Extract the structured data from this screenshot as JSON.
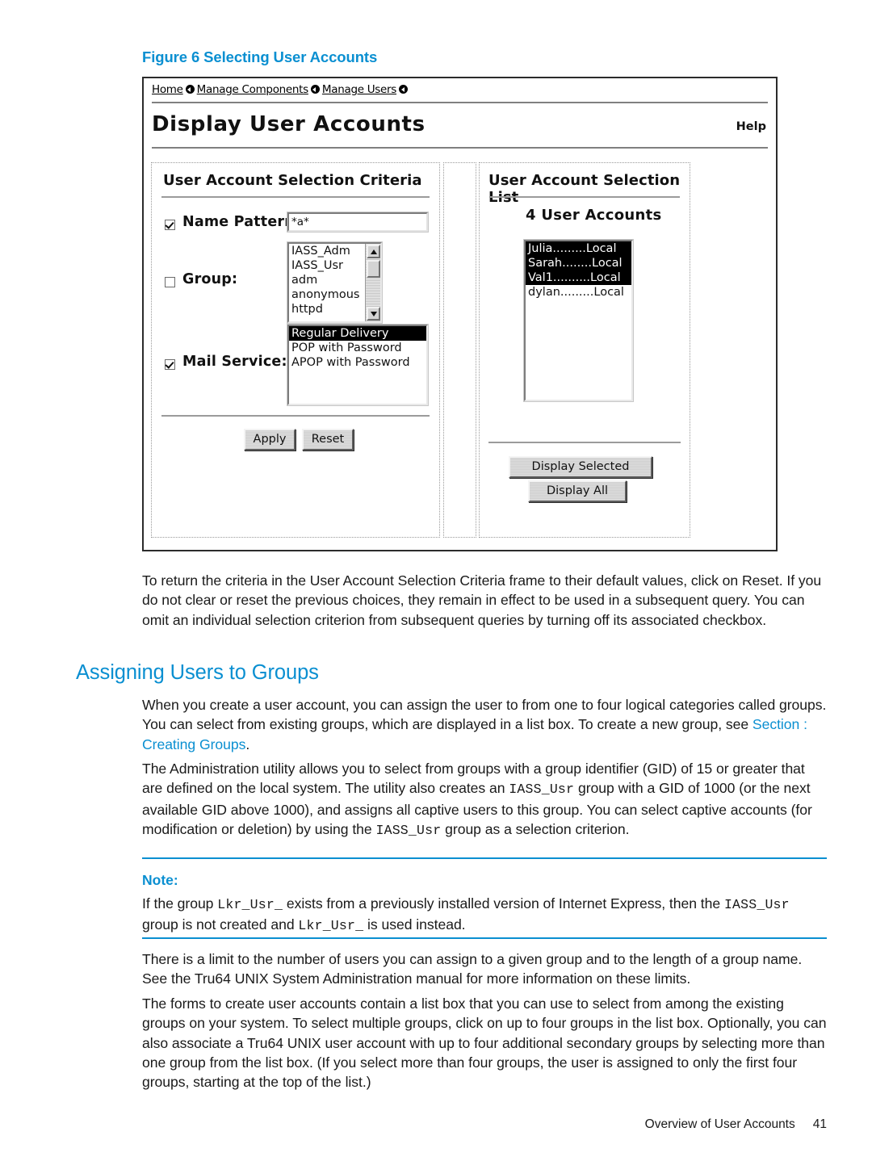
{
  "figure": {
    "number": "Figure 6",
    "title": "Selecting User Accounts"
  },
  "app": {
    "breadcrumb": {
      "items": [
        "Home",
        "Manage Components",
        "Manage Users"
      ]
    },
    "title": "Display User Accounts",
    "help_label": "Help",
    "criteria_panel": {
      "heading": "User Account Selection Criteria",
      "name_pattern": {
        "label": "Name Pattern:",
        "checked": "true",
        "value": "*a*"
      },
      "group": {
        "label": "Group:",
        "checked": "false",
        "options": [
          "IASS_Adm",
          "IASS_Usr",
          "adm",
          "anonymous",
          "httpd"
        ],
        "selected": []
      },
      "mail_service": {
        "label": "Mail Service:",
        "checked": "true",
        "options": [
          "Regular Delivery",
          "POP with Password",
          "APOP with Password"
        ],
        "selected": [
          "Regular Delivery"
        ]
      },
      "apply_label": "Apply",
      "reset_label": "Reset"
    },
    "list_panel": {
      "heading": "User Account Selection List",
      "count_label": "4 User Accounts",
      "accounts": [
        {
          "text": "Julia.........Local",
          "selected": "true"
        },
        {
          "text": "Sarah........Local",
          "selected": "true"
        },
        {
          "text": "Val1..........Local",
          "selected": "true"
        },
        {
          "text": "dylan.........Local",
          "selected": "false"
        }
      ],
      "display_selected_label": "Display Selected",
      "display_all_label": "Display All"
    }
  },
  "body": {
    "p1": "To return the criteria in the User Account Selection Criteria frame to their default values, click on Reset. If you do not clear or reset the previous choices, they remain in effect to be used in a subsequent query. You can omit an individual selection criterion from subsequent queries by turning off its associated checkbox.",
    "heading1": "Assigning Users to Groups",
    "p2_a": "When you create a user account, you can assign the user to from one to four logical categories called groups. You can select from existing groups, which are displayed in a list box. To create a new group, see ",
    "p2_link": "Section : Creating Groups",
    "p2_b": ".",
    "p3_a": "The Administration utility allows you to select from groups with a group identifier (GID) of 15 or greater that are defined on the local system. The utility also creates an ",
    "p3_mono1": "IASS_Usr",
    "p3_b": " group with a GID of 1000 (or the next available GID above 1000), and assigns all captive users to this group. You can select captive accounts (for modification or deletion) by using the ",
    "p3_mono2": "IASS_Usr",
    "p3_c": " group as a selection criterion.",
    "note_label": "Note:",
    "note_a": "If the group ",
    "note_mono1": "Lkr_Usr_",
    "note_b": " exists from a previously installed version of Internet Express, then the ",
    "note_mono2": "IASS_Usr",
    "note_c": " group is not created and ",
    "note_mono3": "Lkr_Usr_",
    "note_d": " is used instead.",
    "p4": "There is a limit to the number of users you can assign to a given group and to the length of a group name. See the Tru64 UNIX System Administration manual for more information on these limits.",
    "p5": "The forms to create user accounts contain a list box that you can use to select from among the existing groups on your system. To select multiple groups, click on up to four groups in the list box. Optionally, you can also associate a Tru64 UNIX user account with up to four additional secondary groups by selecting more than one group from the list box. (If you select more than four groups, the user is assigned to only the first four groups, starting at the top of the list.)"
  },
  "footer": {
    "chapter": "Overview of User Accounts",
    "page": "41"
  },
  "colors": {
    "accent_blue": "#0a8fd1",
    "text": "#1a1a1a",
    "widget_face": "#d4d4d4"
  }
}
